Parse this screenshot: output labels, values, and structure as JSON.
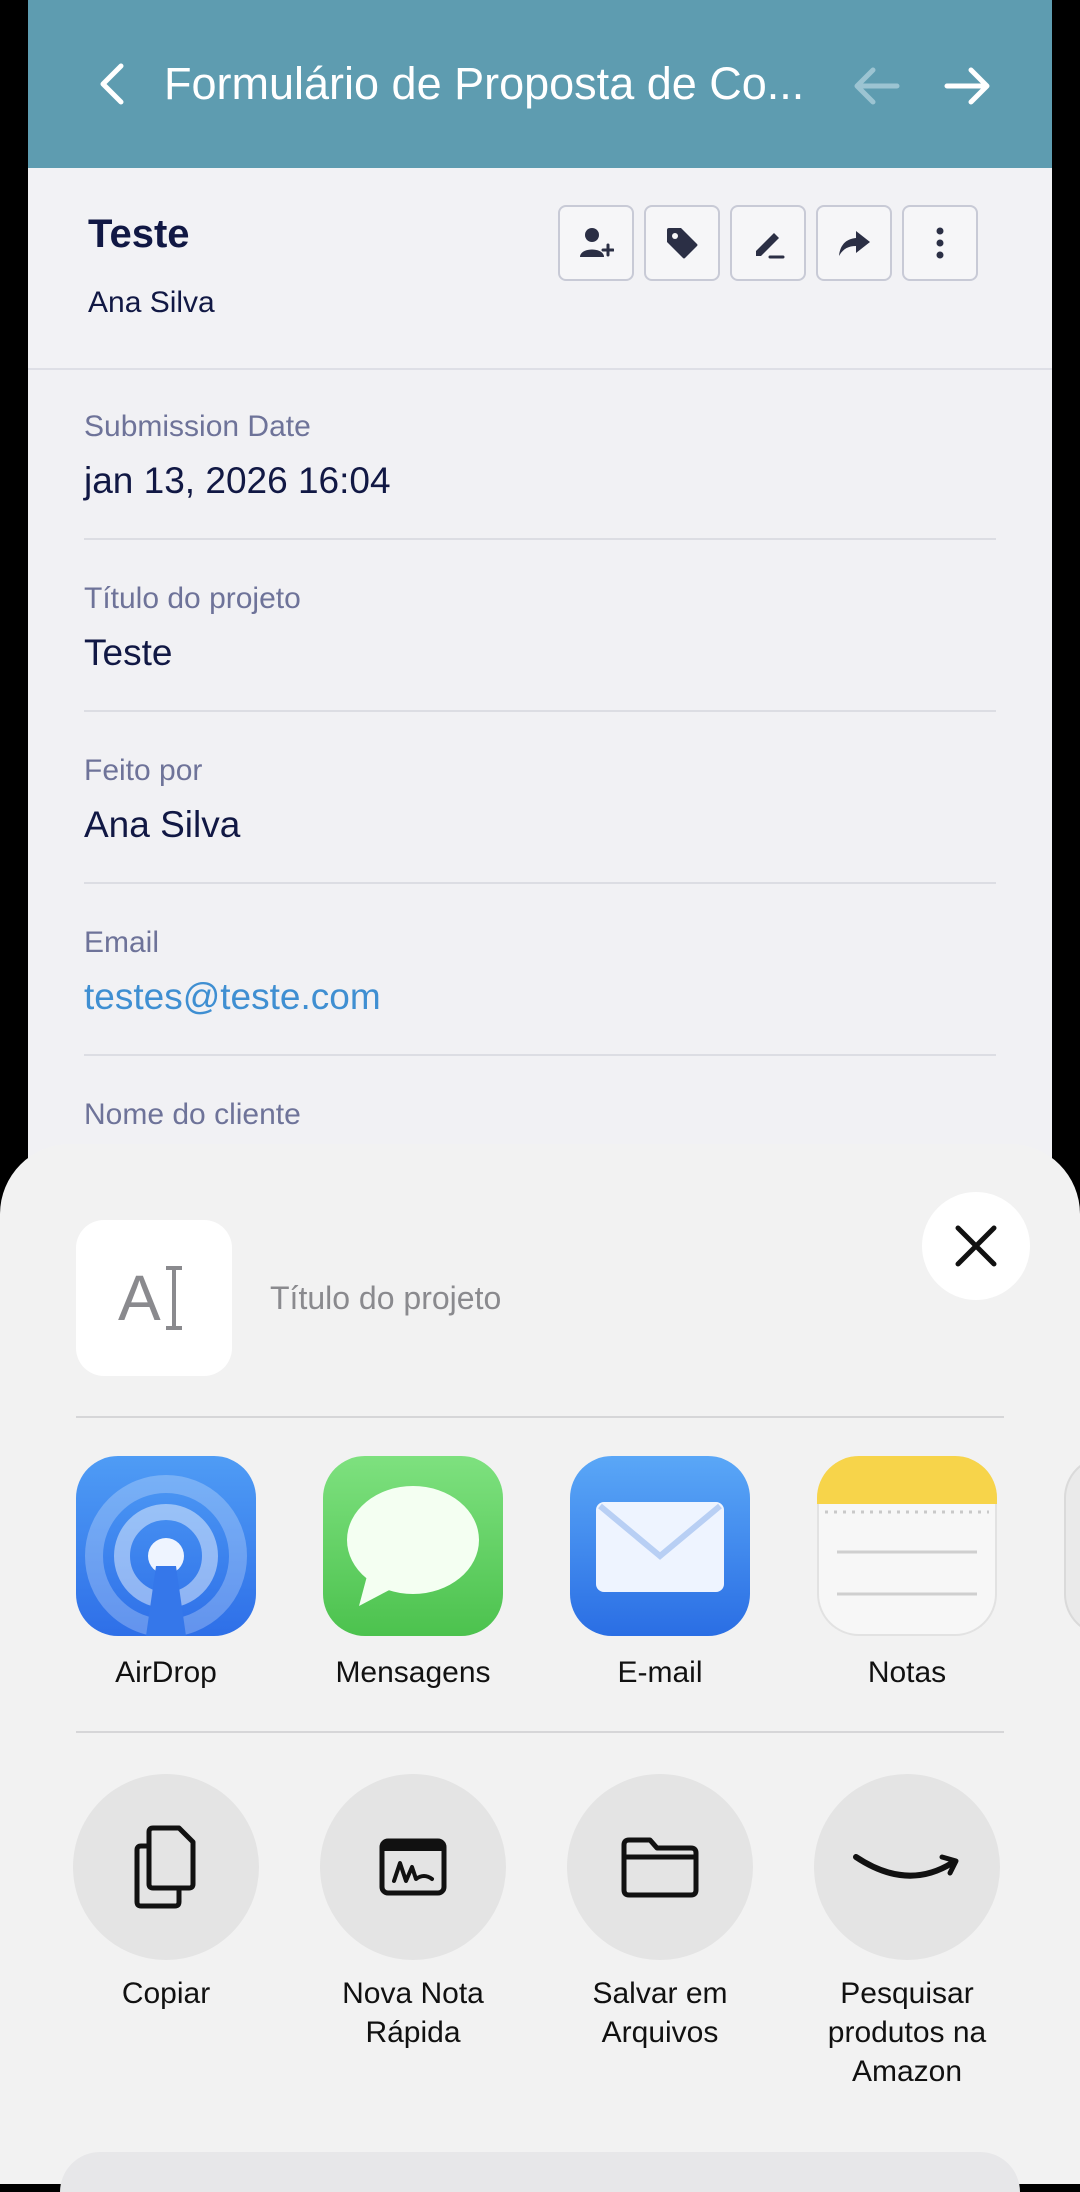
{
  "nav": {
    "title": "Formulário de Proposta de Co..."
  },
  "header": {
    "name": "Teste",
    "subtitle": "Ana Silva"
  },
  "fields": [
    {
      "label": "Submission Date",
      "value": "jan 13, 2026 16:04"
    },
    {
      "label": "Título do projeto",
      "value": "Teste"
    },
    {
      "label": "Feito por",
      "value": "Ana Silva"
    },
    {
      "label": "Email",
      "value": "testes@teste.com"
    },
    {
      "label": "Nome do cliente",
      "value": ""
    }
  ],
  "share": {
    "doc_title": "Título do projeto",
    "doc_icon_text": "A",
    "apps": [
      {
        "label": "AirDrop",
        "icon": "airdrop-icon"
      },
      {
        "label": "Mensagens",
        "icon": "messages-icon"
      },
      {
        "label": "E-mail",
        "icon": "mail-icon"
      },
      {
        "label": "Notas",
        "icon": "notes-icon"
      }
    ],
    "actions": [
      {
        "label": "Copiar",
        "icon": "copy-icon"
      },
      {
        "label": "Nova Nota\nRápida",
        "icon": "quick-note-icon"
      },
      {
        "label": "Salvar em\nArquivos",
        "icon": "folder-icon"
      },
      {
        "label": "Pesquisar\nprodutos na\nAmazon",
        "icon": "amazon-icon"
      }
    ]
  },
  "colors": {
    "nav_bg": "#5e9cb0",
    "link": "#3f8fd2",
    "text_dark": "#111844",
    "label": "#6e7399"
  }
}
